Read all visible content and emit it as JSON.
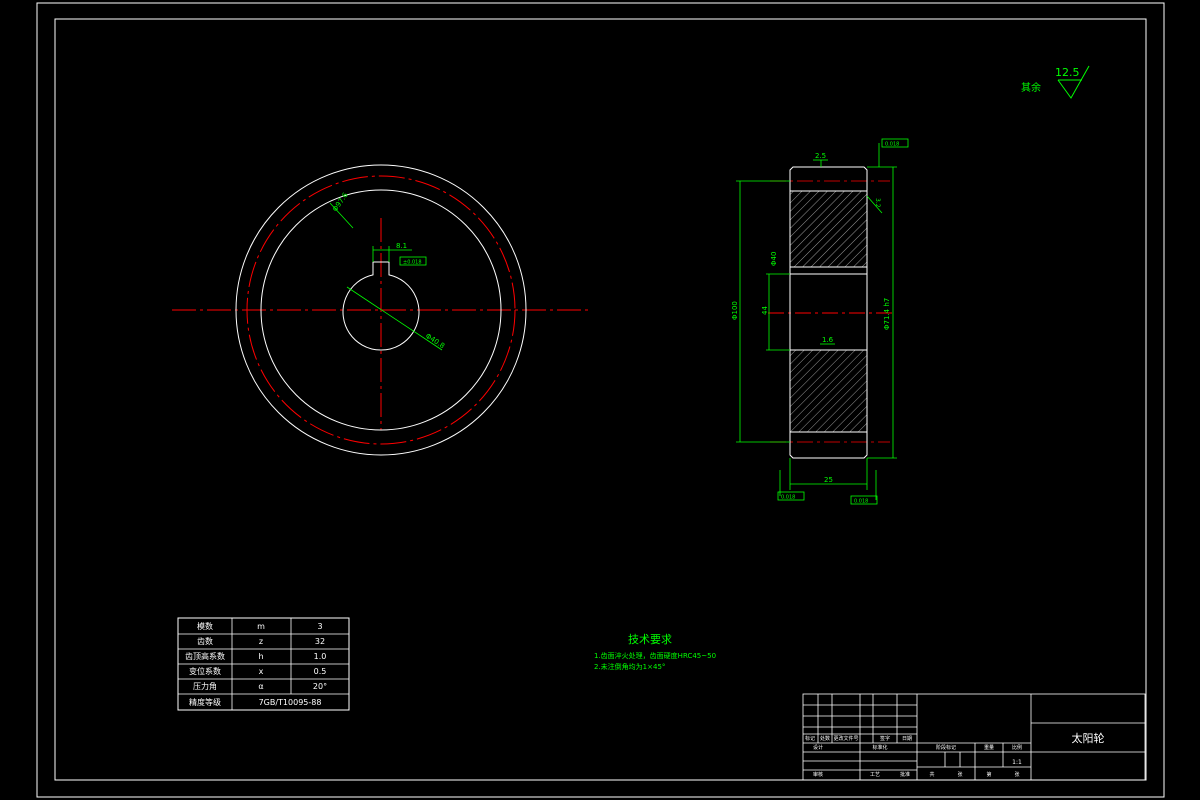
{
  "drawing_title": "太阳轮",
  "roughness": {
    "other_label": "其余",
    "value": "12.5"
  },
  "front_view": {
    "key_width_dim": "8.1",
    "key_tolerance": "±0.018",
    "pitch_dia_label": "Φ97.6",
    "bore_dia_label": "Φ40.8",
    "tol_box": "0.018"
  },
  "side_view": {
    "chamfer_top": "2.5",
    "chamfer_hub": "1.6",
    "roughness_r": "3.2",
    "dim_bore": "Φ40",
    "dim_hub": "44",
    "dim_outer": "Φ100",
    "dim_right": "Φ71.4 h7",
    "dim_width": "25",
    "ref_top": "0.018",
    "ref_bottom_left": "0.018",
    "ref_bottom_right": "0.018"
  },
  "params_table": {
    "rows": [
      [
        "模数",
        "m",
        "3"
      ],
      [
        "齿数",
        "z",
        "32"
      ],
      [
        "齿顶高系数",
        "h",
        "1.0"
      ],
      [
        "变位系数",
        "x",
        "0.5"
      ],
      [
        "压力角",
        "α",
        "20°"
      ],
      [
        "精度等级",
        "",
        "7GB/T10095-88"
      ]
    ]
  },
  "tech_requirements": {
    "title": "技术要求",
    "items": [
      "1.齿面淬火处理，齿面硬度HRC45~50",
      "2.未注倒角均为1×45°"
    ]
  },
  "title_block": {
    "scale": "1:1",
    "labels_left": [
      "标记",
      "处数",
      "更改文件号",
      "签字",
      "日期"
    ],
    "labels_bottom_left": [
      "设计",
      "标准化"
    ],
    "labels_right": [
      "阶段标记",
      "重量",
      "比例"
    ],
    "labels_bottom_right": [
      "共",
      "张",
      "第",
      "张"
    ],
    "labels_misc": [
      "审核",
      "工艺",
      "批准"
    ]
  }
}
